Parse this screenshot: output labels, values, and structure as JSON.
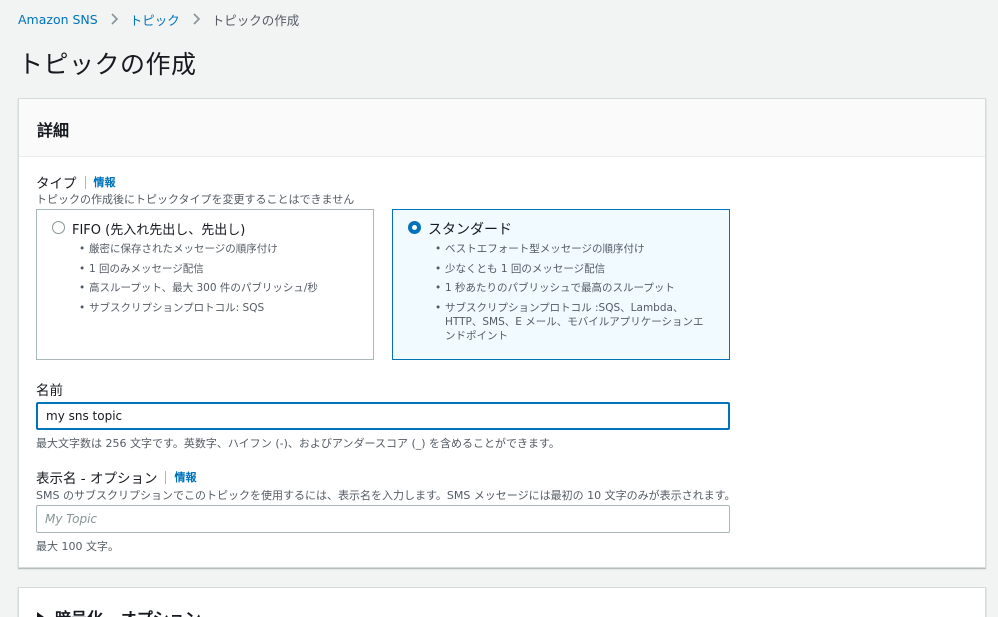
{
  "breadcrumb": {
    "items": [
      "Amazon SNS",
      "トピック",
      "トピックの作成"
    ]
  },
  "page": {
    "title": "トピックの作成"
  },
  "details": {
    "heading": "詳細",
    "type": {
      "label": "タイプ",
      "info": "情報",
      "description": "トピックの作成後にトピックタイプを変更することはできません",
      "options": [
        {
          "title": "FIFO (先入れ先出し、先出し)",
          "selected": false,
          "bullets": [
            "厳密に保存されたメッセージの順序付け",
            "1 回のみメッセージ配信",
            "高スループット、最大 300 件のパブリッシュ/秒",
            "サブスクリプションプロトコル: SQS"
          ]
        },
        {
          "title": "スタンダード",
          "selected": true,
          "bullets": [
            "ベストエフォート型メッセージの順序付け",
            "少なくとも 1 回のメッセージ配信",
            "1 秒あたりのパブリッシュで最高のスループット",
            "サブスクリプションプロトコル :SQS、Lambda、HTTP、SMS、E メール、モバイルアプリケーションエンドポイント"
          ]
        }
      ]
    },
    "name": {
      "label": "名前",
      "value": "my sns topic",
      "constraint": "最大文字数は 256 文字です。英数字、ハイフン (-)、およびアンダースコア (_) を含めることができます。"
    },
    "display_name": {
      "label": "表示名 - オプション",
      "info": "情報",
      "description": "SMS のサブスクリプションでこのトピックを使用するには、表示名を入力します。SMS メッセージには最初の 10 文字のみが表示されます。",
      "placeholder": "My Topic",
      "constraint": "最大 100 文字。"
    }
  },
  "encryption": {
    "heading": "暗号化 - オプション"
  },
  "colors": {
    "link": "#0073bb",
    "selected_bg": "#f1faff",
    "border": "#aab7b8"
  }
}
